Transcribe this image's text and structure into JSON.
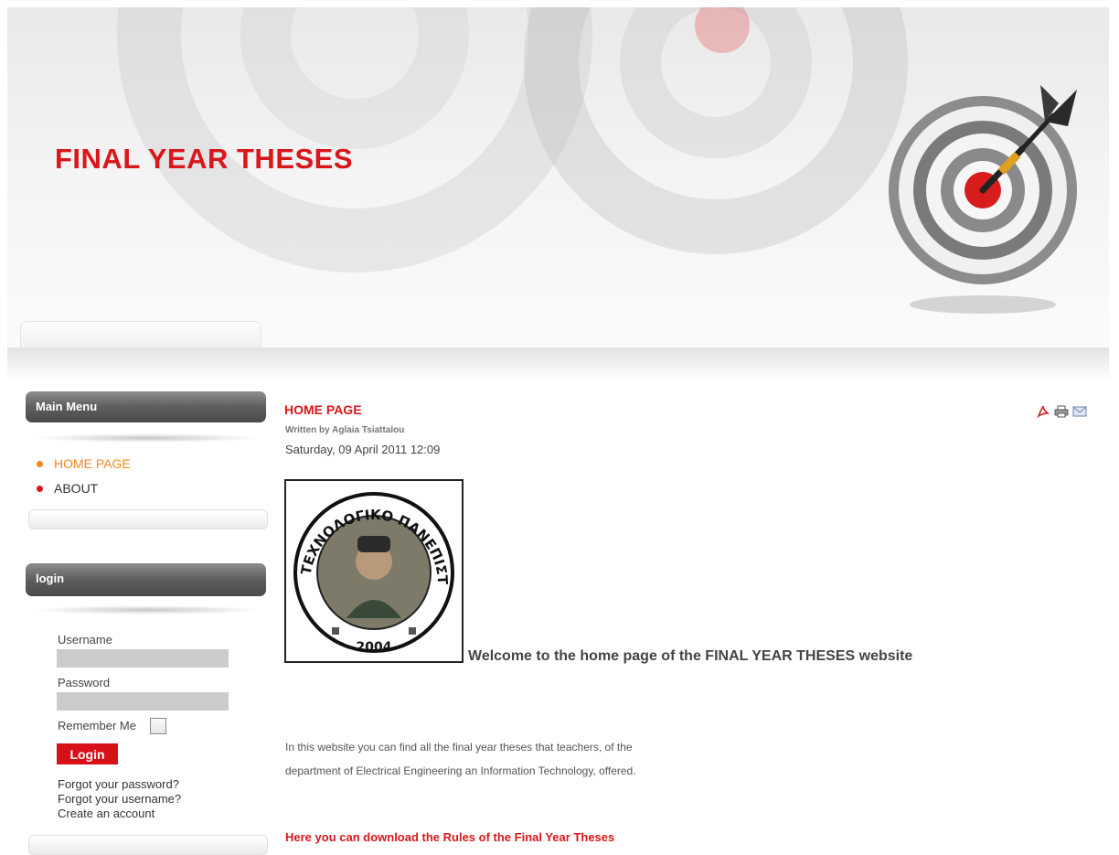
{
  "header": {
    "site_title": "FINAL YEAR THESES"
  },
  "sidebar": {
    "main_menu": {
      "title": "Main Menu",
      "items": [
        {
          "label": "HOME PAGE",
          "active": true
        },
        {
          "label": "ABOUT",
          "active": false
        }
      ]
    },
    "login": {
      "title": "login",
      "username_label": "Username",
      "username_value": "",
      "password_label": "Password",
      "password_value": "",
      "remember_label": "Remember Me",
      "remember_checked": false,
      "login_button": "Login",
      "links": [
        "Forgot your password?",
        "Forgot your username?",
        "Create an account"
      ]
    }
  },
  "article": {
    "title": "HOME PAGE",
    "author": "Written by Aglaia Tsiattalou",
    "date": "Saturday, 09 April 2011 12:09",
    "tools": [
      "pdf-icon",
      "print-icon",
      "email-icon"
    ],
    "logo": {
      "text_top": "ΤΕΧΝΟΛΟΓΙΚΟ ΠΑΝΕΠΙΣΤΗΜΙΟ ΚΥΠΡΟΥ",
      "year": "2004"
    },
    "welcome": "Welcome to the home page of the FINAL YEAR THESES website",
    "body_line_1": "In this website you can find all the final year theses that teachers, of the",
    "body_line_2": "department of Electrical Engineering an Information Technology, offered.",
    "rules_link": "Here you can download the Rules of the Final Year Theses"
  },
  "colors": {
    "accent_red": "#d9161b",
    "active_orange": "#f08a1c",
    "module_header": "#5e5e5e"
  }
}
